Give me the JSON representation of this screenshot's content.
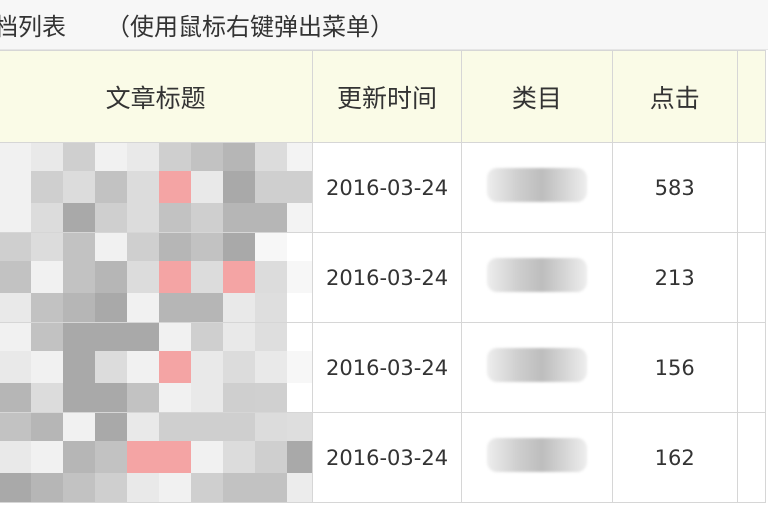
{
  "header": {
    "title": "档列表",
    "hint": "（使用鼠标右键弹出菜单）"
  },
  "table": {
    "columns": [
      "文章标题",
      "更新时间",
      "类目",
      "点击"
    ],
    "rows": [
      {
        "date": "2016-03-24",
        "clicks": "583"
      },
      {
        "date": "2016-03-24",
        "clicks": "213"
      },
      {
        "date": "2016-03-24",
        "clicks": "156"
      },
      {
        "date": "2016-03-24",
        "clicks": "162"
      }
    ]
  },
  "colors": {
    "header_bg": "#fafbe7",
    "border": "#d6d6d6",
    "mosaic_gray": "#c4c4c4",
    "mosaic_pink": "#f4a4a4"
  }
}
